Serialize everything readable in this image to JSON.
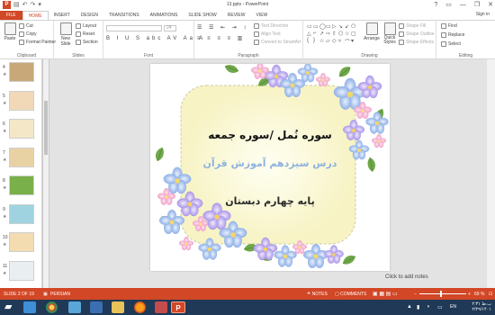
{
  "window": {
    "title": "13.pptx - PowerPoint",
    "app_icon": "P",
    "controls": [
      "?",
      "▭",
      "—",
      "❐",
      "✕"
    ]
  },
  "tabs": [
    "FILE",
    "HOME",
    "INSERT",
    "DESIGN",
    "TRANSITIONS",
    "ANIMATIONS",
    "SLIDE SHOW",
    "REVIEW",
    "VIEW"
  ],
  "account": "Sign in",
  "ribbon": {
    "clipboard": {
      "label": "Clipboard",
      "paste": "Paste",
      "cut": "Cut",
      "copy": "Copy",
      "format_painter": "Format Painter"
    },
    "slides": {
      "label": "Slides",
      "new_slide": "New Slide",
      "layout": "Layout",
      "reset": "Reset",
      "section": "Section"
    },
    "font": {
      "label": "Font",
      "font_name": "",
      "font_size": "24",
      "format_buttons": "B I U S abc AV Aa A"
    },
    "paragraph": {
      "label": "Paragraph",
      "text_direction": "Text Direction",
      "align_text": "Align Text",
      "convert_smartart": "Convert to SmartArt"
    },
    "drawing": {
      "label": "Drawing",
      "arrange": "Arrange",
      "quick_styles": "Quick Styles",
      "shape_fill": "Shape Fill",
      "shape_outline": "Shape Outline",
      "shape_effects": "Shape Effects"
    },
    "editing": {
      "label": "Editing",
      "find": "Find",
      "replace": "Replace",
      "select": "Select"
    }
  },
  "thumbnails": [
    {
      "num": "4",
      "color": "#c8a878"
    },
    {
      "num": "5",
      "color": "#f1d9b8"
    },
    {
      "num": "6",
      "color": "#f4e7c8"
    },
    {
      "num": "7",
      "color": "#e8d2a4"
    },
    {
      "num": "8",
      "color": "#7ab04a"
    },
    {
      "num": "9",
      "color": "#9fd3e0"
    },
    {
      "num": "10",
      "color": "#f2dcb0"
    },
    {
      "num": "11",
      "color": "#e9eef0"
    }
  ],
  "slide": {
    "line1": "سوره نُمل /سوره جمعه",
    "line2": "درس سیزدهم آموزش قرآن",
    "line3": "پایه چهارم دبستان"
  },
  "notes_placeholder": "Click to add notes",
  "status": {
    "slide_count": "SLIDE 2 OF 19",
    "language": "PERSIAN",
    "notes": "NOTES",
    "comments": "COMMENTS",
    "zoom": "69 %"
  },
  "taskbar": {
    "language": "EN",
    "time": "۲:۳۱ ب.ظ",
    "date": "۲/۲۹/۱۴۰۱"
  },
  "colors": {
    "accent": "#d24726",
    "taskbar": "#1f3956",
    "slide_card": "#fdfbe0",
    "title_text": "#111111",
    "subtitle_text": "#8fb3dd",
    "grade_text": "#2a2a2a"
  }
}
